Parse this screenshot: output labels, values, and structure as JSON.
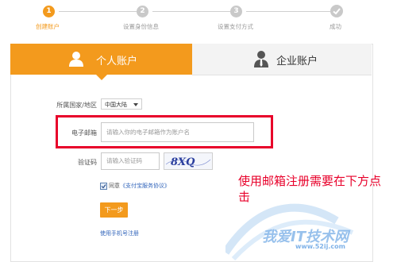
{
  "steps": [
    {
      "number": "1",
      "label": "创建账户",
      "state": "active"
    },
    {
      "number": "2",
      "label": "设置身份信息",
      "state": "inactive"
    },
    {
      "number": "3",
      "label": "设置支付方式",
      "state": "inactive"
    },
    {
      "number": "",
      "label": "成功",
      "state": "inactive",
      "icon": "check-icon"
    }
  ],
  "tabs": {
    "personal": {
      "label": "个人账户",
      "icon": "person-icon"
    },
    "enterprise": {
      "label": "企业账户",
      "icon": "business-person-icon"
    }
  },
  "form": {
    "country_label": "所属国家/地区",
    "country_value": "中国大陆",
    "email_label": "电子邮箱",
    "email_placeholder": "请输入你的电子邮箱作为账户名",
    "captcha_label": "验证码",
    "captcha_placeholder": "请输入验证码",
    "captcha_image_text": "8XQ",
    "agree_prefix": "同意",
    "agree_link": "《支付宝服务协议》",
    "agree_checked": true,
    "next_button": "下一步",
    "phone_register_link": "使用手机号注册"
  },
  "annotation": "使用邮箱注册需要在下方点击",
  "watermark": {
    "text": "我爱IT技术网",
    "url": "www.52ij.com"
  },
  "colors": {
    "accent": "#f39a1d",
    "highlight": "#e8002a",
    "link": "#3366bb"
  }
}
